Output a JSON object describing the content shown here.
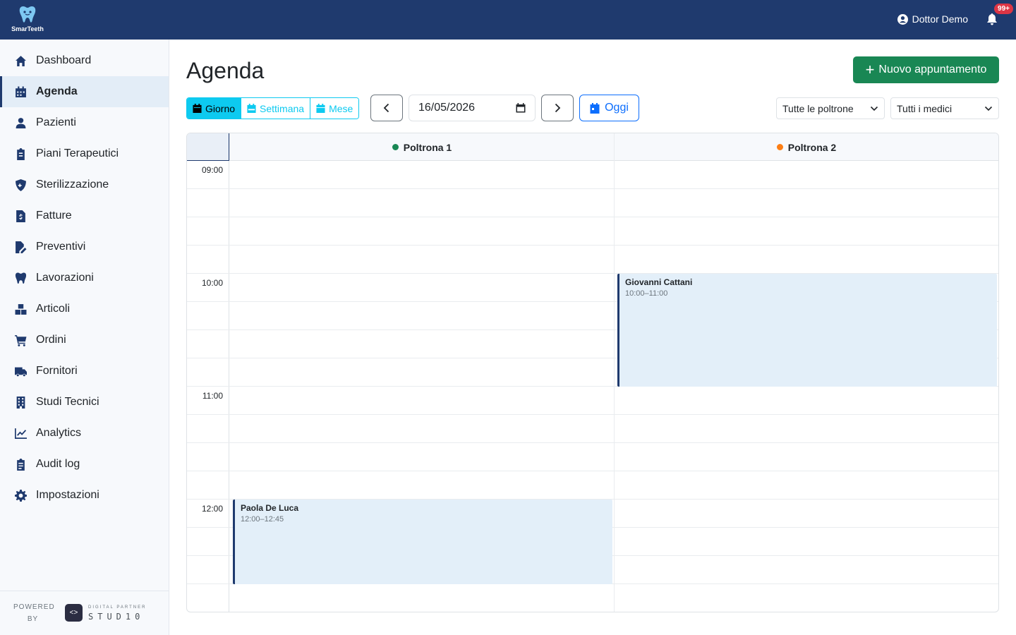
{
  "app": {
    "name": "SmarTeeth"
  },
  "header": {
    "user_name": "Dottor Demo",
    "notifications_badge": "99+"
  },
  "sidebar": {
    "items": [
      {
        "label": "Dashboard",
        "icon": "home-icon"
      },
      {
        "label": "Agenda",
        "icon": "calendar-icon",
        "active": true
      },
      {
        "label": "Pazienti",
        "icon": "user-icon"
      },
      {
        "label": "Piani Terapeutici",
        "icon": "clipboard-icon"
      },
      {
        "label": "Sterilizzazione",
        "icon": "shield-icon"
      },
      {
        "label": "Fatture",
        "icon": "invoice-icon"
      },
      {
        "label": "Preventivi",
        "icon": "file-pen-icon"
      },
      {
        "label": "Lavorazioni",
        "icon": "tooth-icon"
      },
      {
        "label": "Articoli",
        "icon": "boxes-icon"
      },
      {
        "label": "Ordini",
        "icon": "cart-icon"
      },
      {
        "label": "Fornitori",
        "icon": "truck-icon"
      },
      {
        "label": "Studi Tecnici",
        "icon": "building-icon"
      },
      {
        "label": "Analytics",
        "icon": "chart-line-icon"
      },
      {
        "label": "Audit log",
        "icon": "clipboard-list-icon"
      },
      {
        "label": "Impostazioni",
        "icon": "gear-icon"
      }
    ],
    "footer": {
      "powered_line1": "POWERED",
      "powered_line2": "BY",
      "partner_small": "DIGITAL PARTNER",
      "partner_name": "STUD10"
    }
  },
  "page": {
    "title": "Agenda",
    "new_button_label": "Nuovo appuntamento",
    "views": [
      {
        "label": "Giorno",
        "active": true
      },
      {
        "label": "Settimana"
      },
      {
        "label": "Mese"
      }
    ],
    "date_value": "16/05/2026",
    "today_label": "Oggi",
    "chair_filter": "Tutte le poltrone",
    "doctor_filter": "Tutti i medici"
  },
  "calendar": {
    "columns": [
      {
        "name": "Poltrona 1",
        "color": "#198754"
      },
      {
        "name": "Poltrona 2",
        "color": "#fd7e14"
      }
    ],
    "hours": [
      "09:00",
      "10:00",
      "11:00",
      "12:00"
    ],
    "events": [
      {
        "patient": "Giovanni Cattani",
        "time": "10:00–11:00",
        "column": 1
      },
      {
        "patient": "Paola De Luca",
        "time": "12:00–12:45",
        "column": 0
      }
    ]
  },
  "colors": {
    "primary": "#1f3a6e",
    "success": "#198754",
    "info": "#0dcaf0",
    "link": "#0d6efd"
  }
}
